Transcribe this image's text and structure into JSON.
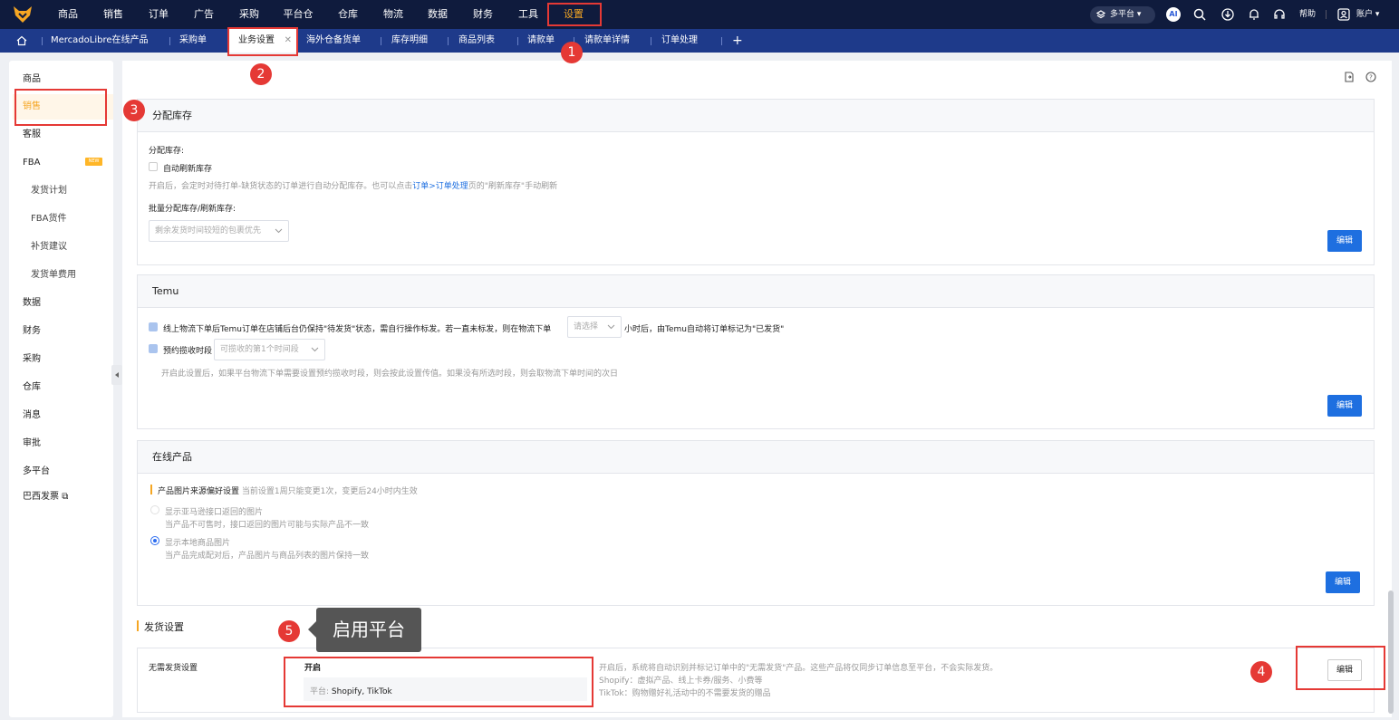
{
  "topnav": {
    "items": [
      "商品",
      "销售",
      "订单",
      "广告",
      "采购",
      "平台仓",
      "仓库",
      "物流",
      "数据",
      "财务",
      "工具",
      "设置"
    ],
    "platform_label": "多平台",
    "ai_label": "AI",
    "help_label": "帮助",
    "account_label": "账户"
  },
  "tabs": {
    "items": [
      "MercadoLibre在线产品",
      "采购单",
      "业务设置",
      "海外仓备货单",
      "库存明细",
      "商品列表",
      "请款单",
      "请款单详情",
      "订单处理"
    ],
    "add_label": "+"
  },
  "sidebar": {
    "items": [
      "商品",
      "销售",
      "客服",
      "FBA",
      "发货计划",
      "FBA货件",
      "补货建议",
      "发货单费用",
      "数据",
      "财务",
      "采购",
      "仓库",
      "消息",
      "审批",
      "多平台",
      "巴西发票"
    ],
    "new_badge": "NEW"
  },
  "sections": {
    "allocate": {
      "title": "分配库存",
      "field_label": "分配库存:",
      "checkbox_label": "自动刷新库存",
      "hint_prefix": "开启后，会定时对待打单-缺货状态的订单进行自动分配库存。也可以点击",
      "hint_link": "订单>订单处理",
      "hint_suffix": "页的\"刷新库存\"手动刷新",
      "batch_label": "批量分配库存/刷新库存:",
      "select_value": "剩余发货时间较短的包裹优先",
      "edit_label": "编辑"
    },
    "temu": {
      "title": "Temu",
      "check1_prefix": "线上物流下单后Temu订单在店铺后台仍保持\"待发货\"状态，需自行操作标发。若一直未标发，则在物流下单",
      "check1_select": "请选择",
      "check1_suffix": "小时后，由Temu自动将订单标记为\"已发货\"",
      "check2_label": "预约揽收时段",
      "check2_select": "可揽收的第1个时间段",
      "hint": "开启此设置后，如果平台物流下单需要设置预约揽收时段，则会按此设置传值。如果没有所选时段，则会取物流下单时间的次日",
      "edit_label": "编辑"
    },
    "online": {
      "title": "在线产品",
      "pref_label": "产品图片来源偏好设置",
      "pref_hint": "当前设置1周只能变更1次，变更后24小时内生效",
      "opt1_title": "显示亚马逊接口返回的图片",
      "opt1_desc": "当产品不可售时，接口返回的图片可能与实际产品不一致",
      "opt2_title": "显示本地商品图片",
      "opt2_desc": "当产品完成配对后，产品图片与商品列表的图片保持一致",
      "edit_label": "编辑"
    },
    "shipping": {
      "title": "发货设置",
      "row_label": "无需发货设置",
      "status": "开启",
      "platform_prefix": "平台:",
      "platform_value": "Shopify, TikTok",
      "desc1": "开启后，系统将自动识别并标记订单中的\"无需发货\"产品。这些产品将仅同步订单信息至平台，不会实际发货。",
      "desc2": "Shopify：虚拟产品、线上卡券/服务、小费等",
      "desc3": "TikTok：购物赠好礼活动中的不需要发货的赠品",
      "edit_label": "编辑"
    }
  },
  "annotations": {
    "markers": [
      "1",
      "2",
      "3",
      "4",
      "5"
    ],
    "tooltip": "启用平台"
  },
  "colors": {
    "nav_bg": "#0f1b3d",
    "tab_bg": "#1e3a8a",
    "accent": "#f5a623",
    "primary": "#1e6fe0",
    "marker": "#e53935"
  }
}
